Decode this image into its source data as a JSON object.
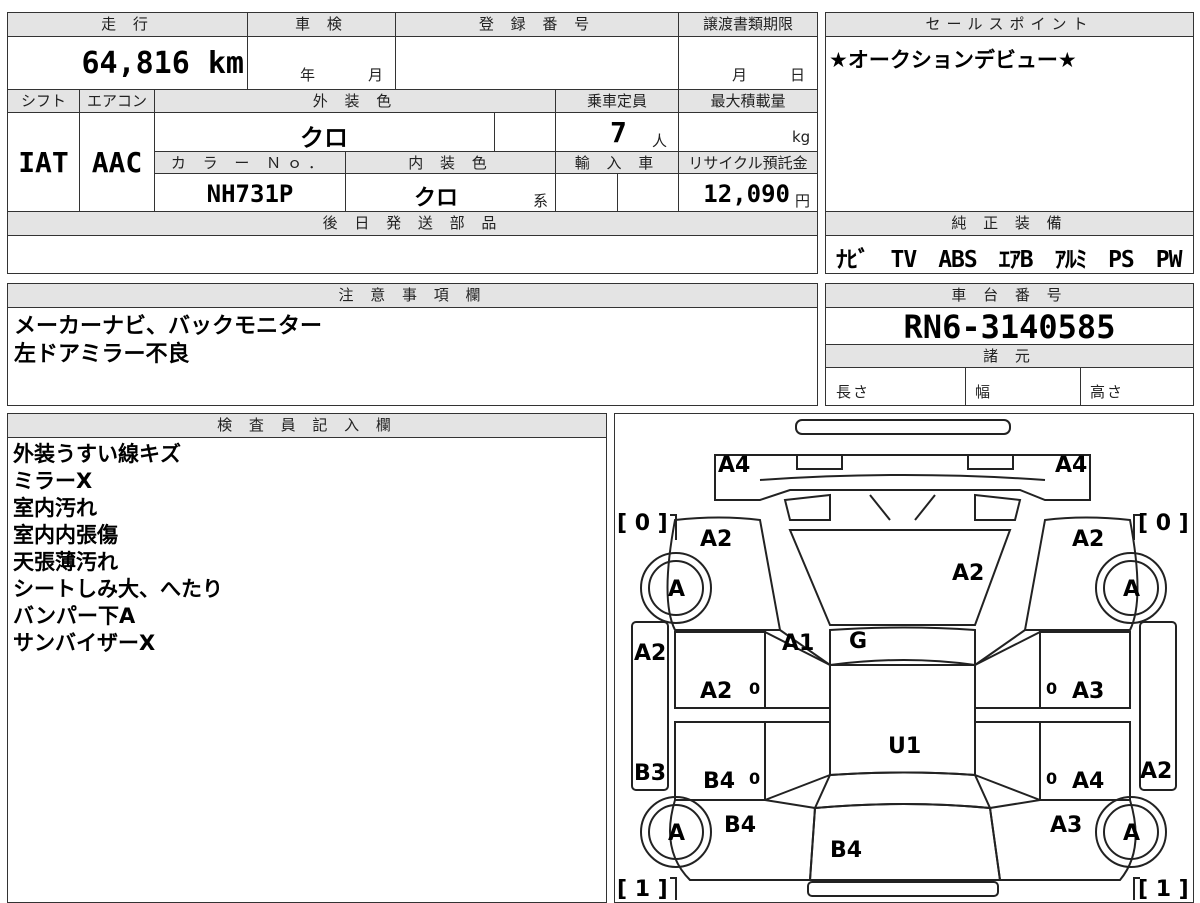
{
  "top": {
    "h_mileage": "走 行",
    "h_shaken": "車 検",
    "h_reg": "登 録 番 号",
    "h_doc": "譲渡書類期限",
    "mileage": "64,816 km",
    "shaken_year": "年",
    "shaken_month": "月",
    "doc_month": "月",
    "doc_day": "日",
    "h_shift": "シフト",
    "h_ac": "エアコン",
    "h_exterior": "外 装 色",
    "h_capacity": "乗車定員",
    "h_maxload": "最大積載量",
    "shift": "IAT",
    "ac": "AAC",
    "exterior_color": "クロ",
    "capacity": "7",
    "capacity_unit": "人",
    "maxload_unit": "kg",
    "h_color_no": "カ ラ ー Ｎｏ．",
    "h_interior": "内 装 色",
    "h_import": "輸 入 車",
    "h_recycle": "リサイクル預託金",
    "color_no": "NH731P",
    "interior_color": "クロ",
    "interior_suffix": "系",
    "recycle": "12,090",
    "recycle_unit": "円",
    "h_later": "後 日 発 送 部 品"
  },
  "sales": {
    "header": "セールスポイント",
    "text": "★オークションデビュー★"
  },
  "equipment": {
    "header": "純 正 装 備",
    "items": "ﾅﾋﾞ　TV　ABS　ｴｱB　ｱﾙﾐ　PS　PW"
  },
  "caution": {
    "header": "注 意 事 項 欄",
    "lines": [
      "メーカーナビ、バックモニター",
      "左ドアミラー不良"
    ]
  },
  "chassis": {
    "header": "車 台 番 号",
    "number": "RN6-3140585",
    "spec_header": "諸 元",
    "length": "長さ",
    "width": "幅",
    "height": "高さ"
  },
  "inspector": {
    "header": "検 査 員 記 入 欄",
    "lines": [
      "外装うすい線キズ",
      "ミラーX",
      "室内汚れ",
      "室内内張傷",
      "天張薄汚れ",
      "シートしみ大、へたり",
      "バンパー下A",
      "サンバイザーX"
    ]
  },
  "diagram": {
    "front_left": "A4",
    "front_right": "A4",
    "tire_fl": "[ 0 ]",
    "tire_fr": "[ 0 ]",
    "tire_rl": "[ 1 ]",
    "tire_rr": "[ 1 ]",
    "fender_fl": "A2",
    "fender_fr": "A2",
    "hood": "A2",
    "wheel_fl": "A",
    "wheel_fr": "A",
    "wheel_rl": "A",
    "wheel_rr": "A",
    "pillar": "A1",
    "windshield": "G",
    "side_left": "A2",
    "door_fl": "A2",
    "door_fl_zero": "0",
    "door_fr": "A3",
    "door_fr_zero": "0",
    "roof": "U1",
    "rocker_left": "B3",
    "door_rl": "B4",
    "door_rl_zero": "0",
    "door_rr": "A4",
    "door_rr_zero": "0",
    "rocker_right": "A2",
    "quarter_left": "B4",
    "quarter_right": "A3",
    "rear": "B4"
  }
}
